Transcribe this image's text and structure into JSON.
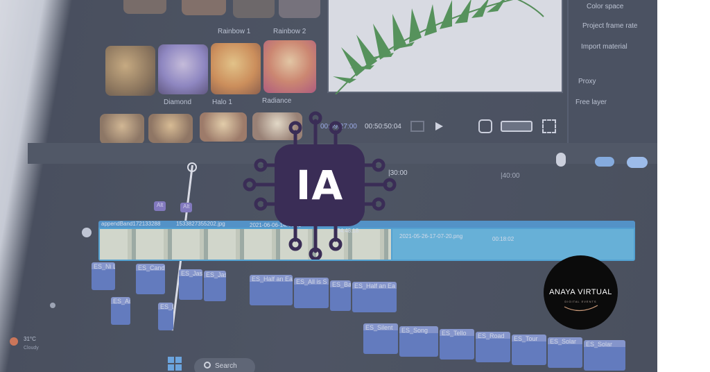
{
  "colors": {
    "chip": "#3a2d56",
    "logo_bg": "#0b0b0b",
    "clip_blue": "#4f6fc4",
    "clip_cyan": "#54b8e6"
  },
  "chip": {
    "label": "IA"
  },
  "logo": {
    "name": "ANAYA VIRTUAL",
    "subtitle": "DIGITAL EVENTS"
  },
  "editor": {
    "filter_labels": [
      "Rainbow 1",
      "Rainbow 2",
      "Diamond",
      "Halo 1",
      "Radiance"
    ],
    "right_panel": [
      "Color space",
      "Project frame rate",
      "Import material",
      "Proxy",
      "Free layer"
    ],
    "playback": {
      "current_time": "00:09:27:00",
      "total_time": "00:50:50:04"
    },
    "ruler_marks": [
      "|30:00",
      "|40:00"
    ],
    "timeline_tags": [
      "Alt",
      "Alt"
    ],
    "video_clips": [
      "appendBand172133288",
      "1533827355202.jpg",
      "2021-06-06-14:44:29",
      "34:48:18",
      "2021-05-26-17-07-20.png",
      "00:18:02"
    ],
    "audio_clips_row1": [
      "ES_Ni Lo",
      "ES_Candi",
      "ES_Jasn",
      "ES_Jasn",
      "ES_Half an Ea",
      "ES_All is S",
      "ES_Bac",
      "ES_Half an Ea"
    ],
    "audio_clips_row2": [
      "ES_Aut",
      "ES_Di"
    ],
    "audio_clips_row3": [
      "ES_Silent",
      "ES_Song",
      "ES_Tello",
      "ES_Road",
      "ES_Tour",
      "ES_Solar",
      "ES_Solar"
    ],
    "taskbar": {
      "weather": "31°C",
      "weather_sub": "Cloudy",
      "search": "Search"
    }
  }
}
